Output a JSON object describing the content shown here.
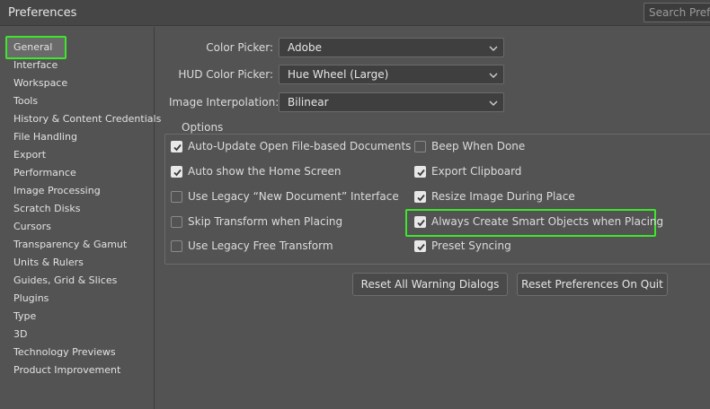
{
  "window": {
    "title": "Preferences",
    "search_placeholder": "Search Prefe"
  },
  "sidebar": {
    "items": [
      {
        "label": "General"
      },
      {
        "label": "Interface"
      },
      {
        "label": "Workspace"
      },
      {
        "label": "Tools"
      },
      {
        "label": "History & Content Credentials"
      },
      {
        "label": "File Handling"
      },
      {
        "label": "Export"
      },
      {
        "label": "Performance"
      },
      {
        "label": "Image Processing"
      },
      {
        "label": "Scratch Disks"
      },
      {
        "label": "Cursors"
      },
      {
        "label": "Transparency & Gamut"
      },
      {
        "label": "Units & Rulers"
      },
      {
        "label": "Guides, Grid & Slices"
      },
      {
        "label": "Plugins"
      },
      {
        "label": "Type"
      },
      {
        "label": "3D"
      },
      {
        "label": "Technology Previews"
      },
      {
        "label": "Product Improvement"
      }
    ],
    "selected": "General"
  },
  "fields": {
    "color_picker": {
      "label": "Color Picker:",
      "value": "Adobe"
    },
    "hud_color_picker": {
      "label": "HUD Color Picker:",
      "value": "Hue Wheel (Large)"
    },
    "image_interpolation": {
      "label": "Image Interpolation:",
      "value": "Bilinear"
    }
  },
  "options": {
    "title": "Options",
    "left": [
      {
        "label": "Auto-Update Open File-based Documents",
        "checked": true
      },
      {
        "label": "Auto show the Home Screen",
        "checked": true
      },
      {
        "label": "Use Legacy “New Document” Interface",
        "checked": false
      },
      {
        "label": "Skip Transform when Placing",
        "checked": false
      },
      {
        "label": "Use Legacy Free Transform",
        "checked": false
      }
    ],
    "right": [
      {
        "label": "Beep When Done",
        "checked": false
      },
      {
        "label": "Export Clipboard",
        "checked": true
      },
      {
        "label": "Resize Image During Place",
        "checked": true
      },
      {
        "label": "Always Create Smart Objects when Placing",
        "checked": true
      },
      {
        "label": "Preset Syncing",
        "checked": true
      }
    ]
  },
  "buttons": {
    "reset_warning": "Reset All Warning Dialogs",
    "reset_quit": "Reset Preferences On Quit"
  },
  "colors": {
    "highlight": "#3ee62c",
    "background": "#535353"
  }
}
